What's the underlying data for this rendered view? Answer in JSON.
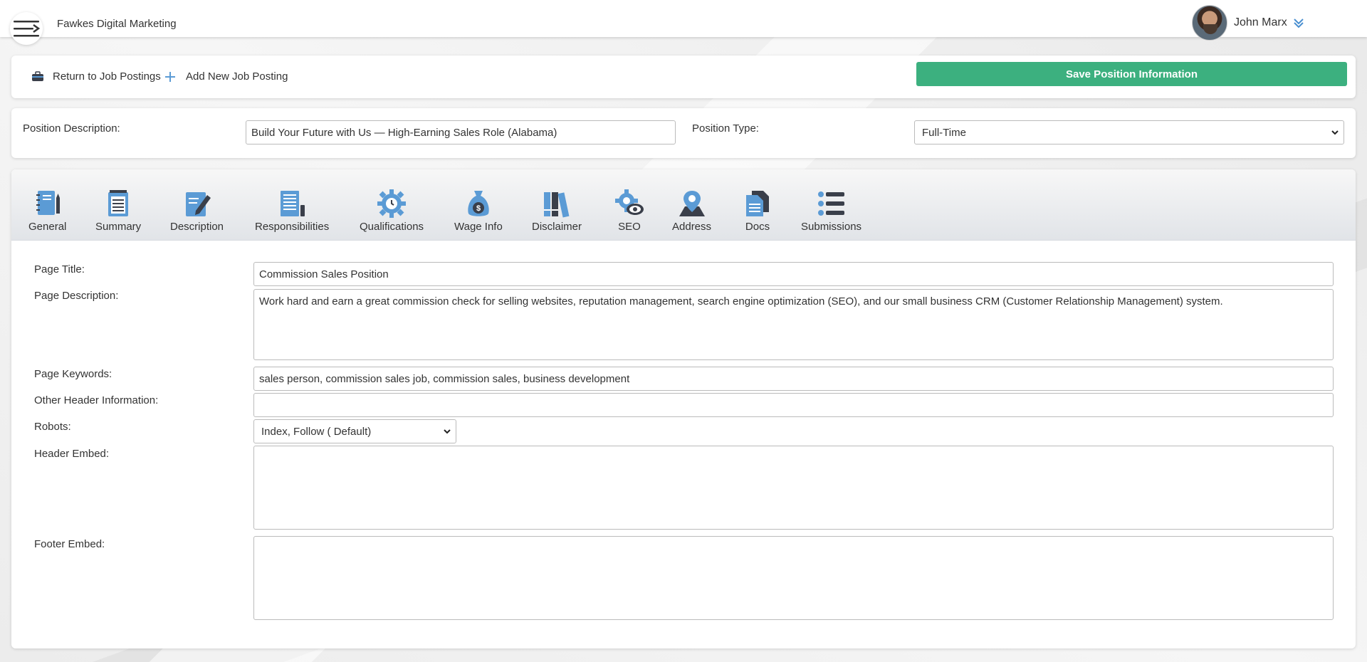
{
  "header": {
    "company": "Fawkes Digital Marketing",
    "user_name": "John Marx"
  },
  "actions": {
    "return_label": "Return to Job Postings",
    "add_label": "Add New Job Posting",
    "save_label": "Save Position Information"
  },
  "position": {
    "description_label": "Position Description:",
    "description_value": "Build Your Future with Us — High-Earning Sales Role (Alabama)",
    "type_label": "Position Type:",
    "type_value": "Full-Time"
  },
  "tabs": [
    {
      "label": "General",
      "icon": "notebook-icon"
    },
    {
      "label": "Summary",
      "icon": "notepad-icon"
    },
    {
      "label": "Description",
      "icon": "edit-document-icon"
    },
    {
      "label": "Responsibilities",
      "icon": "newspaper-icon"
    },
    {
      "label": "Qualifications",
      "icon": "gear-clock-icon"
    },
    {
      "label": "Wage Info",
      "icon": "money-bag-icon"
    },
    {
      "label": "Disclaimer",
      "icon": "books-icon"
    },
    {
      "label": "SEO",
      "icon": "gear-eye-icon"
    },
    {
      "label": "Address",
      "icon": "map-pin-icon"
    },
    {
      "label": "Docs",
      "icon": "documents-icon"
    },
    {
      "label": "Submissions",
      "icon": "list-icon"
    }
  ],
  "seo": {
    "page_title_label": "Page Title:",
    "page_title_value": "Commission Sales Position",
    "page_description_label": "Page Description:",
    "page_description_value": "Work hard and earn a great commission check for selling websites, reputation management, search engine optimization (SEO), and our small business CRM (Customer Relationship Management) system.",
    "page_keywords_label": "Page Keywords:",
    "page_keywords_value": "sales person, commission sales job, commission sales, business development",
    "other_header_label": "Other Header Information:",
    "other_header_value": "",
    "robots_label": "Robots:",
    "robots_value": "Index, Follow ( Default)",
    "header_embed_label": "Header Embed:",
    "header_embed_value": "",
    "footer_embed_label": "Footer Embed:",
    "footer_embed_value": ""
  },
  "colors": {
    "save_button": "#3cb07f",
    "icon_blue": "#5b9bd5",
    "icon_dark": "#3a3f4a"
  }
}
